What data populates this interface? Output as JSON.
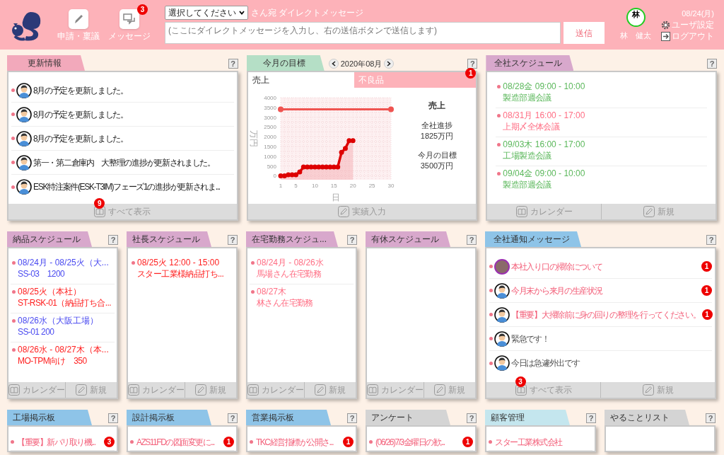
{
  "header": {
    "nav": [
      {
        "label": "申請・稟議",
        "kind": "pen"
      },
      {
        "label": "メッセージ",
        "kind": "chat",
        "badge": "3"
      }
    ],
    "dm": {
      "recipient": "選択してください",
      "suffix": "さん宛 ダイレクトメッセージ",
      "placeholder": "(ここにダイレクトメッセージを入力し、右の送信ボタンで送信します)",
      "send": "送信"
    },
    "user": {
      "initial": "林",
      "name": "林　健太"
    },
    "date": "08/24(月)",
    "links": [
      {
        "label": "ユーザ設定",
        "kind": "gear"
      },
      {
        "label": "ログアウト",
        "kind": "logout"
      }
    ]
  },
  "rows": [
    {
      "panels": [
        {
          "kind": "feed",
          "title": "更新情報",
          "color": "#f2a9bb",
          "help": "?",
          "items": [
            {
              "kind": "person",
              "text": "8月の予定を更新しました。"
            },
            {
              "kind": "person",
              "text": "8月の予定を更新しました。"
            },
            {
              "kind": "person",
              "text": "8月の予定を更新しました。"
            },
            {
              "kind": "person",
              "text": "第一・第二倉庫内　大整理の進捗が更新されました。"
            },
            {
              "kind": "person",
              "text": "ESK特注案件(ESK-T3IM)フェーズ1の進捗が更新されま..."
            }
          ],
          "footer": [
            {
              "label": "すべて表示",
              "kind": "list",
              "badge": "9"
            }
          ]
        },
        {
          "kind": "chart",
          "title": "今月の目標",
          "color": "#b5dfc6",
          "help": "?",
          "month": "2020年08月",
          "badge": "1",
          "tabs": [
            {
              "label": "売上",
              "selected": true
            },
            {
              "label": "不良品",
              "selected": false
            }
          ],
          "summary": {
            "heading": "売上",
            "items": [
              {
                "label": "全社進捗",
                "value": "1825万円"
              },
              {
                "label": "今月の目標",
                "value": "3500万円"
              }
            ]
          },
          "chart_data": {
            "type": "line",
            "xlabel": "日",
            "ylabel": "万円",
            "x": [
              1,
              2,
              3,
              4,
              5,
              6,
              7,
              8,
              9,
              10,
              11,
              12,
              13,
              14,
              15,
              16,
              17,
              18,
              19,
              20,
              21,
              22,
              23,
              24,
              25,
              26,
              27,
              28,
              29,
              30
            ],
            "xlim": [
              1,
              30
            ],
            "ylim": [
              -200,
              4000
            ],
            "xticks": [
              1,
              5,
              10,
              15,
              20,
              25,
              30
            ],
            "yticks": [
              0,
              500,
              1000,
              1500,
              2000,
              2500,
              3000,
              3500,
              4000
            ],
            "grid": true,
            "series": [
              {
                "color": "#ef5350",
                "values": [
                  3400,
                  3400,
                  3400,
                  3400,
                  3400,
                  3400,
                  3400,
                  3400,
                  3400,
                  3400,
                  3400,
                  3400,
                  3400,
                  3400,
                  3400,
                  3400,
                  3400,
                  3400,
                  3400,
                  3400,
                  3400,
                  3400,
                  3400,
                  3400,
                  3400,
                  3400,
                  3400,
                  3400,
                  3400,
                  3400
                ]
              },
              {
                "color": "#dd0000",
                "marker": true,
                "values": [
                  0,
                  0,
                  50,
                  50,
                  50,
                  200,
                  450,
                  450,
                  450,
                  450,
                  450,
                  450,
                  450,
                  450,
                  450,
                  450,
                  1200,
                  1400,
                  1800,
                  1800,
                  null,
                  null,
                  null,
                  null,
                  null,
                  null,
                  null,
                  null,
                  null,
                  null
                ]
              }
            ]
          },
          "footer": [
            {
              "label": "実績入力",
              "kind": "new"
            }
          ]
        },
        {
          "kind": "schedule",
          "title": "全社スケジュール",
          "color": "#d8a8cc",
          "help": "?",
          "items": [
            {
              "when": "08/28金 09:00 - 10:00",
              "what": "製造部週会議",
              "color": "#5cb85c"
            },
            {
              "when": "08/31月 16:00 - 17:00",
              "what": "上期〆全体会議",
              "color": "#ff6e84"
            },
            {
              "when": "09/03木 16:00 - 17:00",
              "what": "工場製造会議",
              "color": "#5cb85c"
            },
            {
              "when": "09/04金 09:00 - 10:00",
              "what": "製造部週会議",
              "color": "#5cb85c"
            }
          ],
          "footer": [
            {
              "label": "カレンダー",
              "kind": "calendar"
            },
            {
              "label": "新規",
              "kind": "new"
            }
          ]
        }
      ]
    },
    {
      "panels": [
        {
          "kind": "schedule",
          "title": "納品スケジュール",
          "color": "#d8a8cc",
          "help": "?",
          "items": [
            {
              "when": "08/24月 - 08/25火（大...",
              "what": "SS-03　1200",
              "color": "#4a4af0"
            },
            {
              "when": "08/25火（本社）",
              "what": "ST-RSK-01（納品打ち合...",
              "color": "#ff2020"
            },
            {
              "when": "08/26水（大阪工場）",
              "what": "SS-01 200",
              "color": "#4a4af0"
            },
            {
              "when": "08/26水 - 08/27木（本...",
              "what": "MO-TPM向け　350",
              "color": "#ff2020"
            }
          ],
          "footer": [
            {
              "label": "カレンダー",
              "kind": "calendar"
            },
            {
              "label": "新規",
              "kind": "new"
            }
          ]
        },
        {
          "kind": "schedule",
          "title": "社長スケジュール",
          "color": "#d8a8cc",
          "help": "?",
          "items": [
            {
              "when": "08/25火 12:00 - 15:00",
              "what": "スター工業様納品打ち...",
              "color": "#ff2020"
            }
          ],
          "footer": [
            {
              "label": "カレンダー",
              "kind": "calendar"
            },
            {
              "label": "新規",
              "kind": "new"
            }
          ]
        },
        {
          "kind": "schedule",
          "title": "在宅勤務スケジュ...",
          "color": "#d8a8cc",
          "help": "?",
          "items": [
            {
              "when": "08/24月 - 08/26水",
              "what": "馬場さん在宅勤務",
              "color": "#ff6e84"
            },
            {
              "when": "08/27木",
              "what": "林さん在宅勤務",
              "color": "#ff6e84"
            }
          ],
          "footer": [
            {
              "label": "カレンダー",
              "kind": "calendar"
            },
            {
              "label": "新規",
              "kind": "new"
            }
          ]
        },
        {
          "kind": "schedule",
          "title": "有休スケジュール",
          "color": "#d8a8cc",
          "help": "?",
          "footer": [
            {
              "label": "カレンダー",
              "kind": "calendar"
            },
            {
              "label": "新規",
              "kind": "new"
            }
          ]
        },
        {
          "kind": "feed",
          "title": "全社通知メッセージ",
          "color": "#8ec4e8",
          "help": "?",
          "items": [
            {
              "kind": "photo",
              "text": "本社入り口の掃除について",
              "unread": true,
              "badge": "1"
            },
            {
              "kind": "person",
              "text": "今月末から来月の生産状況",
              "unread": true,
              "badge": "1"
            },
            {
              "kind": "person",
              "text": "【重要】大掃除前に身の回りの整理を行ってください。",
              "unread": true,
              "badge": "1"
            },
            {
              "kind": "person",
              "text": "緊急です！",
              "unread": false
            },
            {
              "kind": "person",
              "text": "今日は急遽外出です",
              "unread": false
            }
          ],
          "footer": [
            {
              "label": "すべて表示",
              "kind": "list",
              "badge": "3"
            },
            {
              "label": "新規",
              "kind": "new"
            }
          ]
        }
      ]
    },
    {
      "panels": [
        {
          "kind": "board",
          "title": "工場掲示板",
          "color": "#8ec4e8",
          "help": "?",
          "items": [
            {
              "text": "【重要】新バリ取り機...",
              "badge": "3"
            }
          ]
        },
        {
          "kind": "board",
          "title": "設計掲示板",
          "color": "#8ec4e8",
          "help": "?",
          "items": [
            {
              "text": "AZS11FDの図面変更に...",
              "badge": "1"
            }
          ]
        },
        {
          "kind": "board",
          "title": "営業掲示板",
          "color": "#8ec4e8",
          "help": "?",
          "items": [
            {
              "text": "TKC経営指標が公開さ...",
              "badge": "1"
            }
          ]
        },
        {
          "kind": "board",
          "title": "アンケート",
          "color": "#d4d4d4",
          "help": "?",
          "items": [
            {
              "text": "(06/26)7/3金曜日の歓...",
              "badge": "1"
            }
          ]
        },
        {
          "kind": "board",
          "title": "顧客管理",
          "color": "#c4e6ee",
          "help": "?",
          "items": [
            {
              "text": "スター工業株式会社"
            }
          ]
        },
        {
          "kind": "board",
          "title": "やることリスト",
          "color": "#d4d4d4",
          "help": "?"
        }
      ]
    }
  ]
}
